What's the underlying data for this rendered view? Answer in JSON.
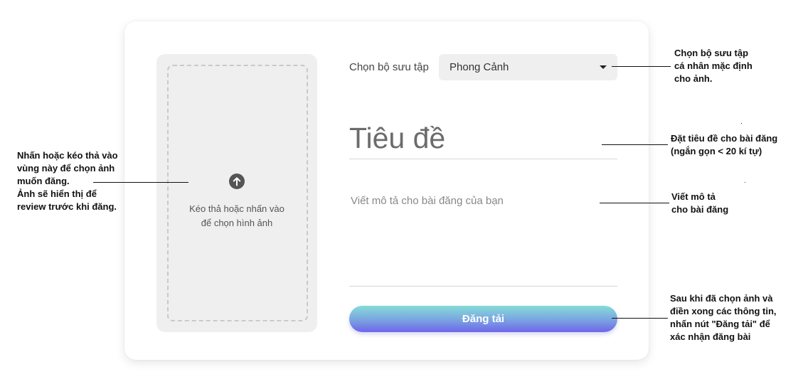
{
  "upload": {
    "text_line1": "Kéo thả hoặc nhấn vào",
    "text_line2": "để chọn hình ảnh",
    "icon": "arrow-up-circle-icon"
  },
  "collection": {
    "label": "Chọn bộ sưu tập",
    "selected": "Phong Cảnh",
    "icon": "caret-down-icon"
  },
  "title_field": {
    "placeholder": "Tiêu đề"
  },
  "description_field": {
    "placeholder": "Viết mô tả cho bài đăng của bạn"
  },
  "submit": {
    "label": "Đăng tải"
  },
  "annotations": {
    "collection": [
      "Chọn bộ sưu tập",
      "cá nhân mặc định",
      "cho ảnh."
    ],
    "title": [
      "Đặt tiêu đề cho bài đăng",
      "(ngắn gọn < 20 kí tự)"
    ],
    "description": [
      "Viết mô tả",
      "cho bài đăng"
    ],
    "upload": [
      "Nhấn hoặc kéo thả vào",
      "vùng này để chọn ảnh",
      "muốn đăng.",
      "Ảnh sẽ hiển thị để",
      "review trước khi đăng."
    ],
    "submit": [
      "Sau khi đã chọn ảnh và",
      "điền xong các thông tin,",
      "nhấn nút \"Đăng tải\" để",
      "xác nhận đăng bài"
    ]
  },
  "colors": {
    "button_gradient_top": "#86dcd8",
    "button_gradient_bottom": "#6f66ea",
    "field_background": "#efefef"
  }
}
